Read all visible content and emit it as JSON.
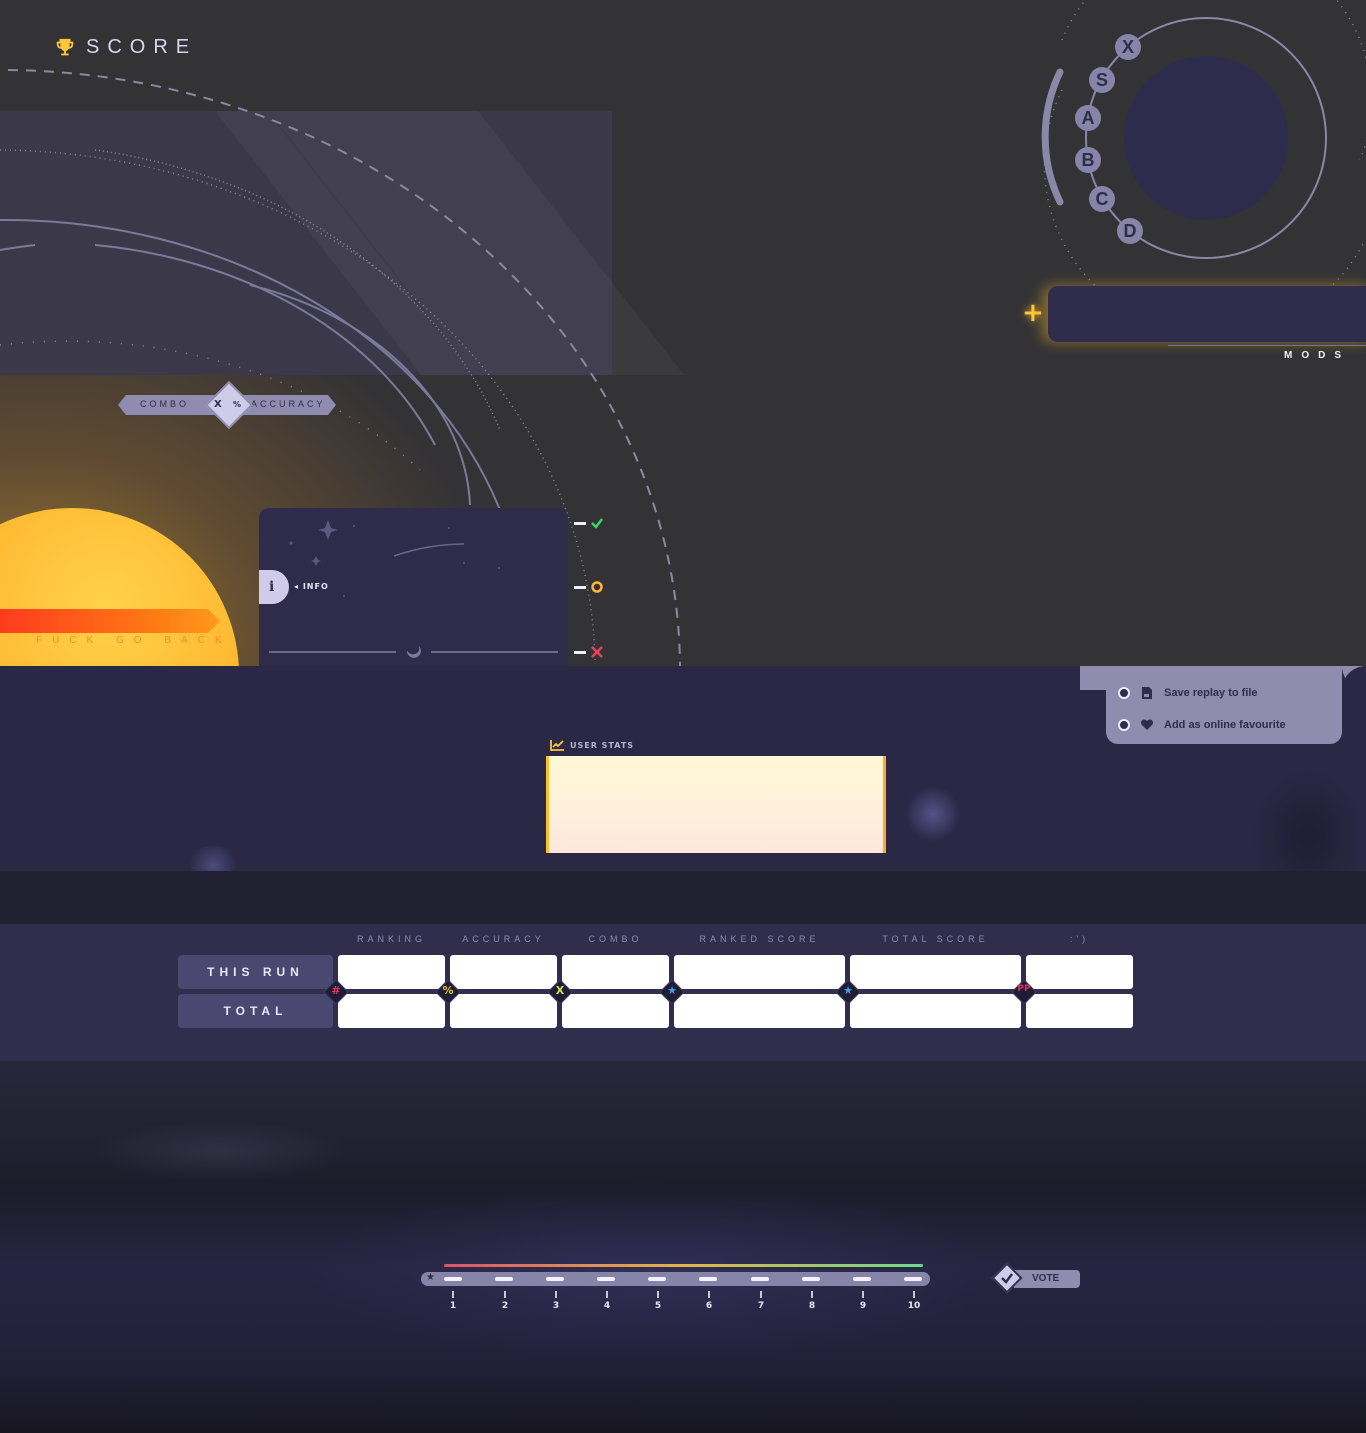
{
  "header": {
    "title": "SCORE",
    "icon": "trophy-icon"
  },
  "combo_accuracy": {
    "left_label": "COMBO",
    "right_label": "ACCURACY",
    "left_glyph": "X",
    "right_glyph": "%"
  },
  "back_button": {
    "label": "FUCK GO BACK"
  },
  "info_card": {
    "label": "INFO",
    "icon_glyph": "i"
  },
  "judgements": [
    {
      "icon": "check-icon",
      "color": "#3ad46a"
    },
    {
      "icon": "circle-icon",
      "color": "#ffb43a"
    },
    {
      "icon": "cross-icon",
      "color": "#e8445e"
    }
  ],
  "ranks": [
    "X",
    "S",
    "A",
    "B",
    "C",
    "D"
  ],
  "mods": {
    "label": "MODS",
    "add_glyph": "+"
  },
  "actions": [
    {
      "label": "Save replay to file",
      "icon": "file-icon"
    },
    {
      "label": "Add as online favourite",
      "icon": "heart-icon"
    }
  ],
  "user_stats": {
    "label": "USER STATS",
    "icon": "chart-line-icon"
  },
  "table": {
    "columns": [
      "RANKING",
      "ACCURACY",
      "COMBO",
      "RANKED SCORE",
      "TOTAL SCORE",
      ":')"
    ],
    "rows": [
      {
        "label": "THIS RUN",
        "values": [
          "",
          "",
          "",
          "",
          "",
          ""
        ]
      },
      {
        "label": "TOTAL",
        "values": [
          "",
          "",
          "",
          "",
          "",
          ""
        ]
      }
    ],
    "separators": [
      {
        "glyph": "#",
        "color": "#e0306a"
      },
      {
        "glyph": "%",
        "color": "#e8c43a"
      },
      {
        "glyph": "X",
        "color": "#cfe25a"
      },
      {
        "glyph": "★",
        "color": "#3aa0f0"
      },
      {
        "glyph": "★",
        "color": "#3aa0f0"
      },
      {
        "glyph": "PP",
        "color": "#e0306a"
      }
    ]
  },
  "rating": {
    "ticks": [
      "1",
      "2",
      "3",
      "4",
      "5",
      "6",
      "7",
      "8",
      "9",
      "10"
    ],
    "star_glyph": "★"
  },
  "vote": {
    "label": "VOTE",
    "icon": "check-icon"
  },
  "colors": {
    "accent": "#ffc63a",
    "panel": "#2f2c4c",
    "lavender": "#8f8cb0",
    "background": "#333235"
  }
}
